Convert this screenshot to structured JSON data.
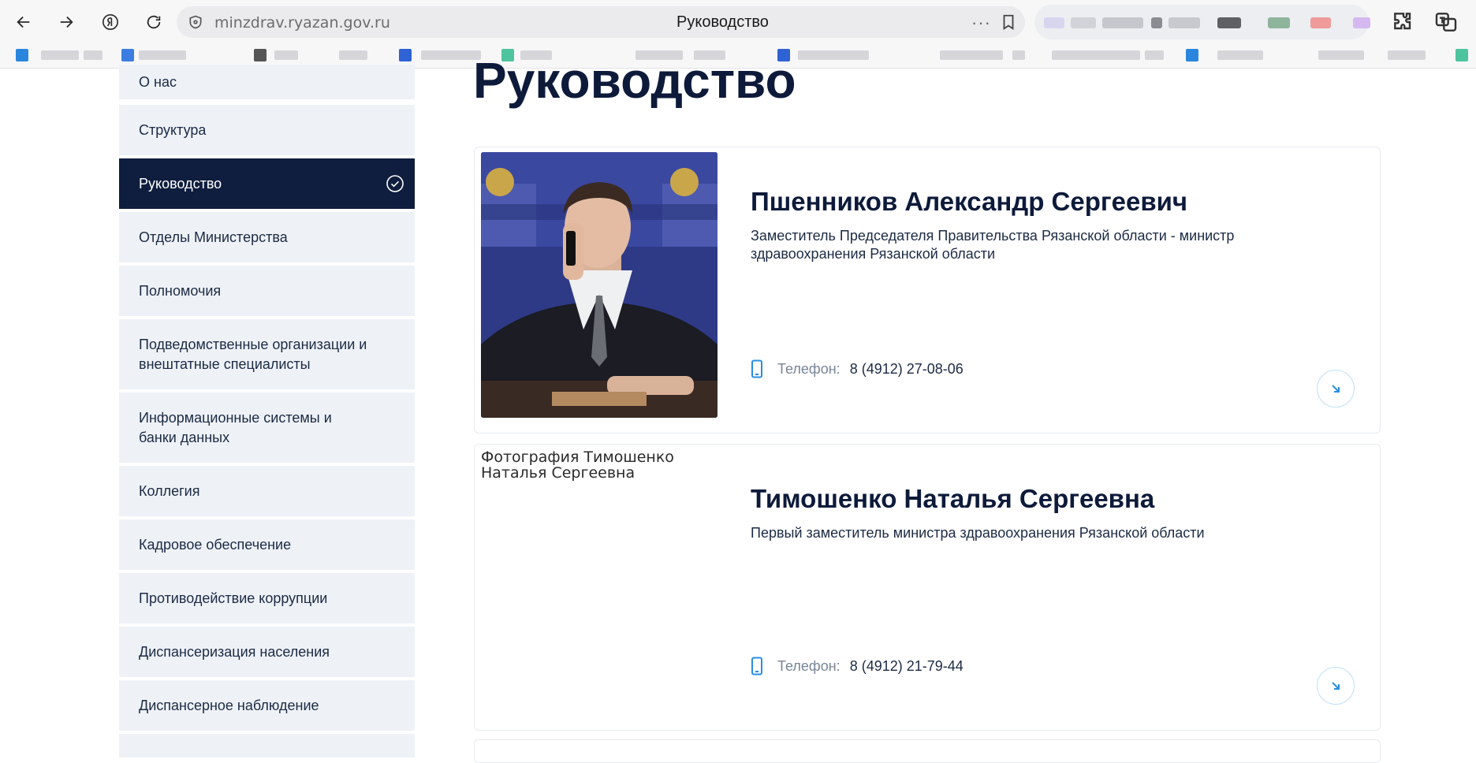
{
  "browser": {
    "domain": "minzdrav.ryazan.gov.ru",
    "page_title": "Руководство",
    "more_label": "···"
  },
  "sidebar": {
    "items": [
      {
        "label": "О нас"
      },
      {
        "label": "Структура"
      },
      {
        "label": "Руководство"
      },
      {
        "label": "Отделы Министерства"
      },
      {
        "label": "Полномочия"
      },
      {
        "label": "Подведомственные организации и внештатные специалисты"
      },
      {
        "label": "Информационные системы и банки данных"
      },
      {
        "label": "Коллегия"
      },
      {
        "label": "Кадровое обеспечение"
      },
      {
        "label": "Противодействие коррупции"
      },
      {
        "label": "Диспансеризация населения"
      },
      {
        "label": "Диспансерное наблюдение"
      }
    ]
  },
  "main": {
    "heading": "Руководство",
    "phone_label": "Телефон:",
    "leaders": [
      {
        "name": "Пшенников Александр Сергеевич",
        "position": "Заместитель Председателя Правительства Рязанской области - министр здравоохранения Рязанской области",
        "phone": "8 (4912) 27-08-06"
      },
      {
        "name": "Тимошенко Наталья Сергеевна",
        "position": "Первый заместитель министра здравоохранения Рязанской области",
        "phone": "8 (4912) 21-79-44",
        "photo_alt": "Фотография Тимошенко Наталья Сергеевна"
      }
    ]
  },
  "colors": {
    "primary_dark": "#0f1e3e",
    "sidebar_bg": "#eef2f7",
    "accent_blue": "#2a8de4"
  }
}
